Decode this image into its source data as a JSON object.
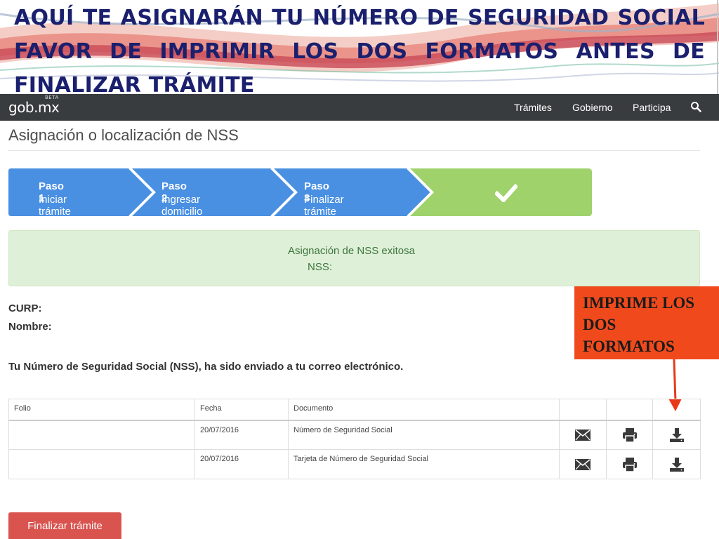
{
  "banner": {
    "line1": "AQUÍ TE ASIGNARÁN TU NÚMERO DE SEGURIDAD SOCIAL",
    "line2": "FAVOR DE IMPRIMIR LOS DOS FORMATOS ANTES DE",
    "line3": "FINALIZAR TRÁMITE"
  },
  "navbar": {
    "logo": "gob.mx",
    "logo_badge": "BETA",
    "items": [
      "Trámites",
      "Gobierno",
      "Participa"
    ],
    "search_icon": "search-icon"
  },
  "page": {
    "title": "Asignación o localización de NSS"
  },
  "steps": [
    {
      "title": "Paso 1",
      "subtitle": "Iniciar trámite"
    },
    {
      "title": "Paso 2",
      "subtitle": "Ingresar domicilio"
    },
    {
      "title": "Paso 3",
      "subtitle": "Finalizar trámite"
    },
    {
      "icon": "checkmark-icon"
    }
  ],
  "colors": {
    "step_blue": "#4a90e2",
    "step_done": "#9fd26b",
    "alert_bg": "#dff0d8",
    "danger": "#d9534f",
    "callout": "#f04a1c"
  },
  "alert": {
    "message": "Asignación de NSS exitosa",
    "nss_label": "NSS:"
  },
  "info": {
    "curp_label": "CURP:",
    "nombre_label": "Nombre:",
    "notice": "Tu Número de Seguridad Social (NSS), ha sido enviado a tu correo electrónico."
  },
  "callout": {
    "line1": "IMPRIME LOS",
    "line2": "DOS",
    "line3": "FORMATOS"
  },
  "table": {
    "headers": {
      "folio": "Folio",
      "fecha": "Fecha",
      "documento": "Documento"
    },
    "rows": [
      {
        "folio": "",
        "fecha": "20/07/2016",
        "documento": "Número de Seguridad Social"
      },
      {
        "folio": "",
        "fecha": "20/07/2016",
        "documento": "Tarjeta de Número de Seguridad Social"
      }
    ],
    "row_icons": [
      "envelope-icon",
      "printer-icon",
      "download-icon"
    ]
  },
  "buttons": {
    "finalize": "Finalizar trámite"
  }
}
